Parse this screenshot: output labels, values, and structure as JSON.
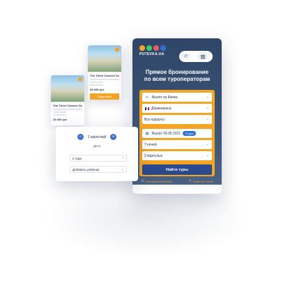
{
  "brand": {
    "name": "PUTEVKA.UA",
    "dot_colors": [
      "#f5a524",
      "#3ec96b",
      "#f05a5a",
      "#2f6fd6"
    ]
  },
  "header": {
    "phone_icon": "phone-icon",
    "menu_icon": "hamburger-icon"
  },
  "hero": {
    "title_line1": "Прямое бронирование",
    "title_line2": "по всем туроператорам"
  },
  "form": {
    "departure": "Вылет из Киева",
    "country": "Доминикана",
    "resorts": "Все курорты",
    "date": "Вылет 29.05.2021",
    "date_badge": "+3 дня",
    "nights": "7 ночей",
    "adults": "2 взрослых",
    "search_button": "Найти туры"
  },
  "footer": {
    "left": "Расширенный поиск",
    "right": "Поиск по отелю"
  },
  "popup": {
    "count_label": "1 взрослый",
    "child_label": "Дети",
    "child_age": "2 года",
    "add_child": "Добавить ребенка"
  },
  "cards": [
    {
      "name": "The Three Corners Ocean View",
      "tag": "",
      "price": "29 000 грн",
      "button": "Подробнее"
    },
    {
      "name": "The Three Corners Ocean View",
      "tag": "",
      "price": "29 000 грн",
      "button": ""
    }
  ],
  "colors": {
    "accent": "#f5a524",
    "primary": "#2a4a8c",
    "header_bg": "#2f4669"
  }
}
